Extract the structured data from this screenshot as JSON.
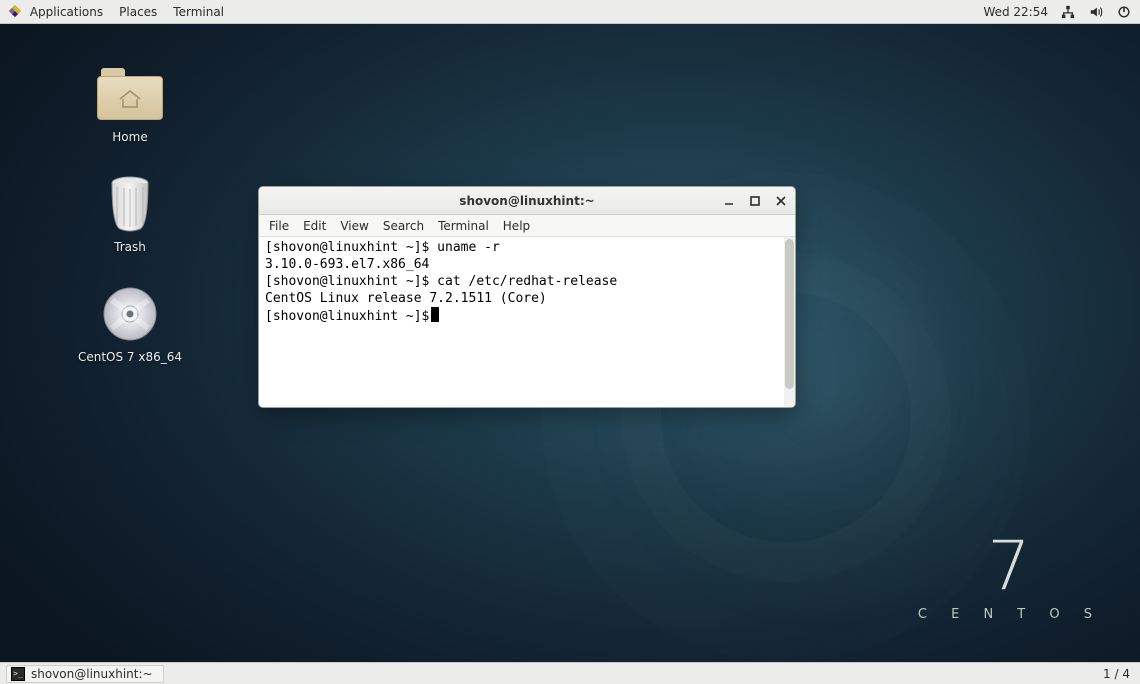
{
  "top_panel": {
    "applications": "Applications",
    "places": "Places",
    "terminal": "Terminal",
    "clock": "Wed 22:54"
  },
  "desktop": {
    "home_label": "Home",
    "trash_label": "Trash",
    "cd_label": "CentOS 7 x86_64"
  },
  "wallpaper": {
    "version": "7",
    "name": "C E N T O S"
  },
  "window": {
    "title": "shovon@linuxhint:~",
    "menu": {
      "file": "File",
      "edit": "Edit",
      "view": "View",
      "search": "Search",
      "terminal": "Terminal",
      "help": "Help"
    },
    "lines": {
      "l1": "[shovon@linuxhint ~]$ uname -r",
      "l2": "3.10.0-693.el7.x86_64",
      "l3": "[shovon@linuxhint ~]$ cat /etc/redhat-release",
      "l4": "CentOS Linux release 7.2.1511 (Core)",
      "l5": "[shovon@linuxhint ~]$"
    }
  },
  "bottom_panel": {
    "task_label": "shovon@linuxhint:~",
    "workspace": "1 / 4"
  }
}
